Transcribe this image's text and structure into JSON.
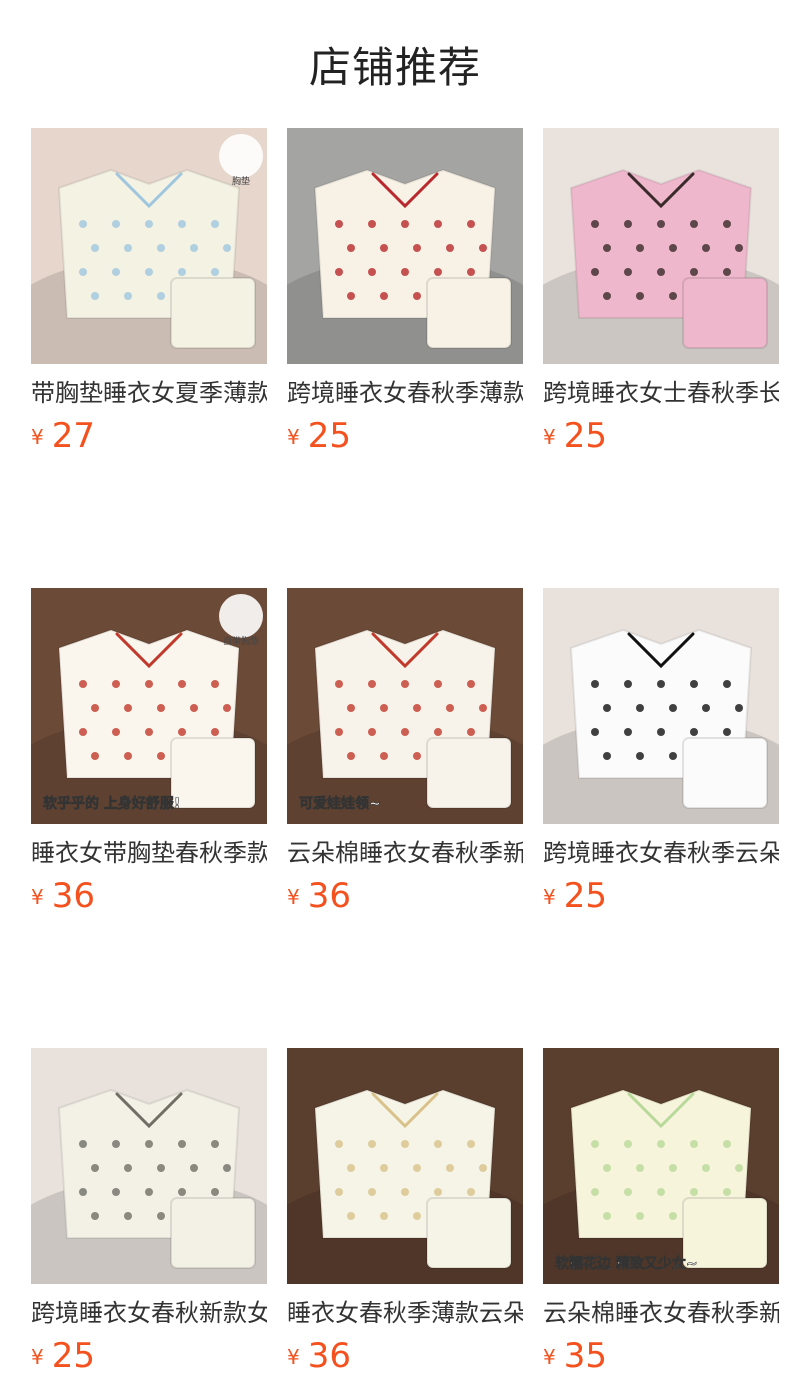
{
  "page_title": "店铺推荐",
  "products": [
    {
      "name": "带胸垫睡衣女夏季薄款",
      "price": "27",
      "currency": "¥",
      "image": {
        "bg": "#e6d6cb",
        "garment": "#f4f2e3",
        "accent": "#9fc6df",
        "badge": "胸垫",
        "overlay": ""
      }
    },
    {
      "name": "跨境睡衣女春秋季薄款",
      "price": "25",
      "currency": "¥",
      "image": {
        "bg": "#a4a4a2",
        "garment": "#f8f2e6",
        "accent": "#b8282c",
        "badge": "",
        "overlay": ""
      }
    },
    {
      "name": "跨境睡衣女士春秋季长",
      "price": "25",
      "currency": "¥",
      "image": {
        "bg": "#e9e2dd",
        "garment": "#eeb7cc",
        "accent": "#3a2a2a",
        "badge": "",
        "overlay": ""
      }
    },
    {
      "name": "睡衣女带胸垫春秋季款",
      "price": "36",
      "currency": "¥",
      "image": {
        "bg": "#6b4a37",
        "garment": "#faf6ee",
        "accent": "#c0392b",
        "badge": "自带胸垫",
        "overlay": "软乎乎的 上身好舒服!"
      }
    },
    {
      "name": "云朵棉睡衣女春秋季新",
      "price": "36",
      "currency": "¥",
      "image": {
        "bg": "#6b4a37",
        "garment": "#f8f3ea",
        "accent": "#c0392b",
        "badge": "",
        "overlay": "可爱娃娃领~"
      }
    },
    {
      "name": "跨境睡衣女春秋季云朵",
      "price": "25",
      "currency": "¥",
      "image": {
        "bg": "#e8e1dc",
        "garment": "#fbfbfb",
        "accent": "#111111",
        "badge": "",
        "overlay": ""
      }
    },
    {
      "name": "跨境睡衣女春秋新款女",
      "price": "25",
      "currency": "¥",
      "image": {
        "bg": "#e8e1dc",
        "garment": "#f3f0e6",
        "accent": "#6f6f66",
        "badge": "",
        "overlay": ""
      }
    },
    {
      "name": "睡衣女春秋季薄款云朵",
      "price": "36",
      "currency": "¥",
      "image": {
        "bg": "#5a3e2e",
        "garment": "#f6f4e7",
        "accent": "#d9c28a",
        "badge": "",
        "overlay": ""
      }
    },
    {
      "name": "云朵棉睡衣女春秋季新",
      "price": "35",
      "currency": "¥",
      "image": {
        "bg": "#5a3e2e",
        "garment": "#f7f4dc",
        "accent": "#b9d99a",
        "badge": "",
        "overlay": "软糯花边 精致又少女~"
      }
    }
  ]
}
